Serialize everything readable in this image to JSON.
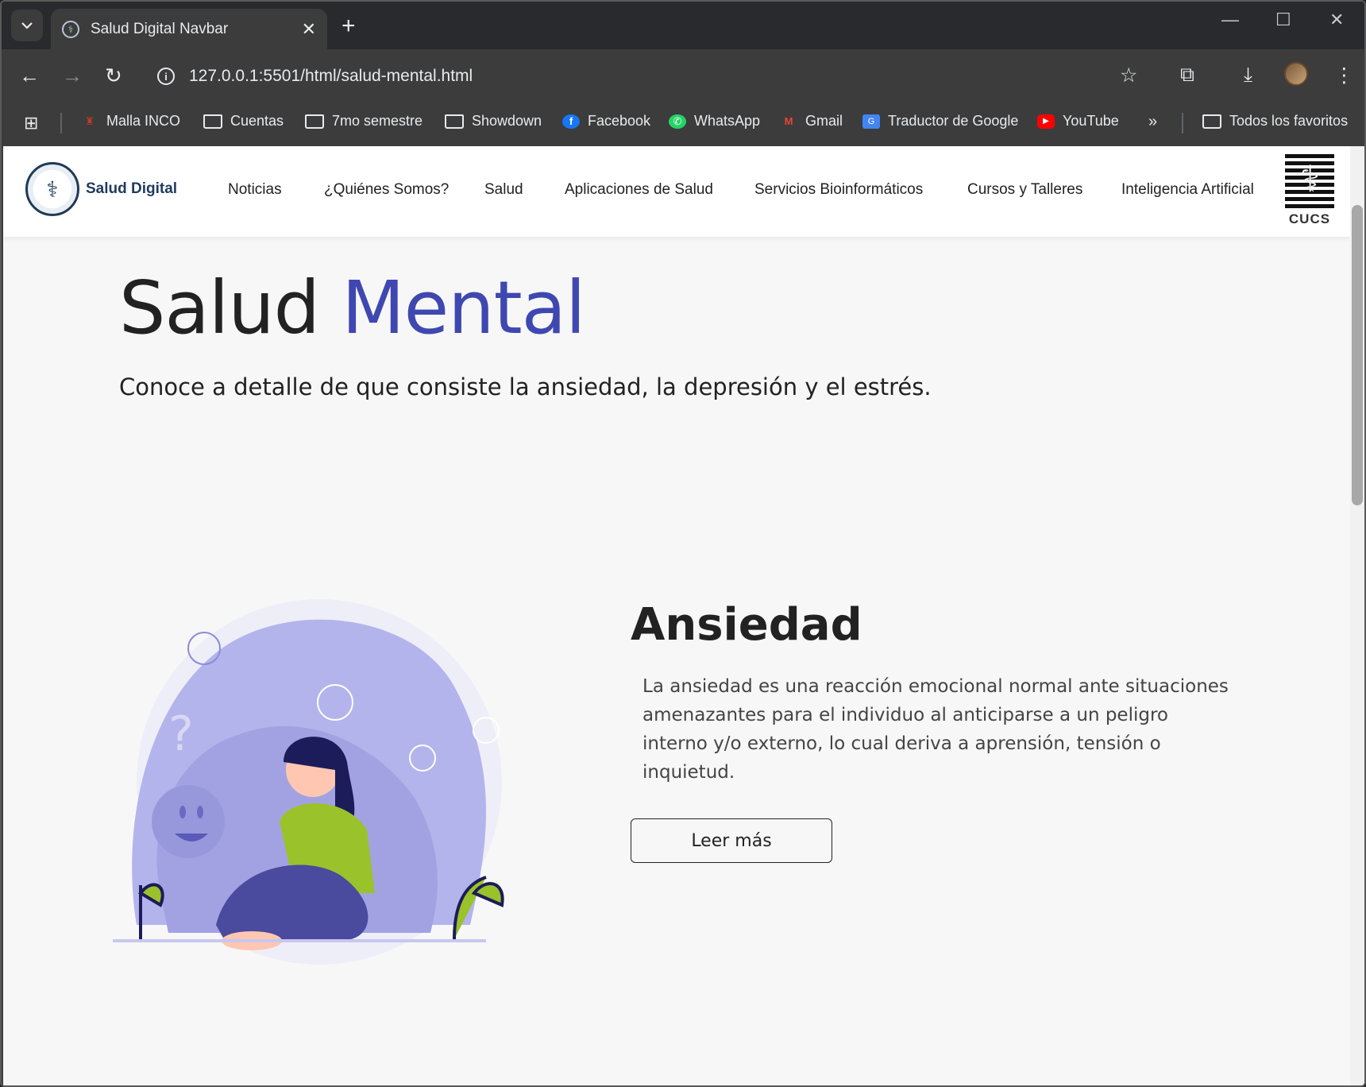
{
  "browser": {
    "tab_title": "Salud Digital Navbar",
    "url": "127.0.0.1:5501/html/salud-mental.html",
    "bookmarks": [
      {
        "label": "Malla INCO",
        "icon": "malla-icon"
      },
      {
        "label": "Cuentas",
        "icon": "folder-icon"
      },
      {
        "label": "7mo semestre",
        "icon": "folder-icon"
      },
      {
        "label": "Showdown",
        "icon": "folder-icon"
      },
      {
        "label": "Facebook",
        "icon": "facebook-icon"
      },
      {
        "label": "WhatsApp",
        "icon": "whatsapp-icon"
      },
      {
        "label": "Gmail",
        "icon": "gmail-icon"
      },
      {
        "label": "Traductor de Google",
        "icon": "translate-icon"
      },
      {
        "label": "YouTube",
        "icon": "youtube-icon"
      }
    ],
    "all_bookmarks": "Todos los favoritos"
  },
  "navbar": {
    "brand": "Salud Digital",
    "links": [
      "Noticias",
      "¿Quiénes Somos?",
      "Salud",
      "Aplicaciones de Salud",
      "Servicios Bioinformáticos",
      "Cursos y Talleres",
      "Inteligencia Artificial"
    ],
    "right_logo_text": "CUCS"
  },
  "hero": {
    "title_part1": "Salud",
    "title_part2": "Mental",
    "subtitle": "Conoce a detalle de que consiste la ansiedad, la depresión y el estrés."
  },
  "section": {
    "title": "Ansiedad",
    "body": "La ansiedad es una reacción emocional normal ante situaciones amenazantes para el individuo al anticiparse a un peligro interno y/o externo, lo cual deriva a aprensión, tensión o inquietud.",
    "button": "Leer más"
  },
  "colors": {
    "accent": "#3f48b0",
    "illustration_purple": "#a6a6e6",
    "illustration_green": "#9ac22a"
  }
}
